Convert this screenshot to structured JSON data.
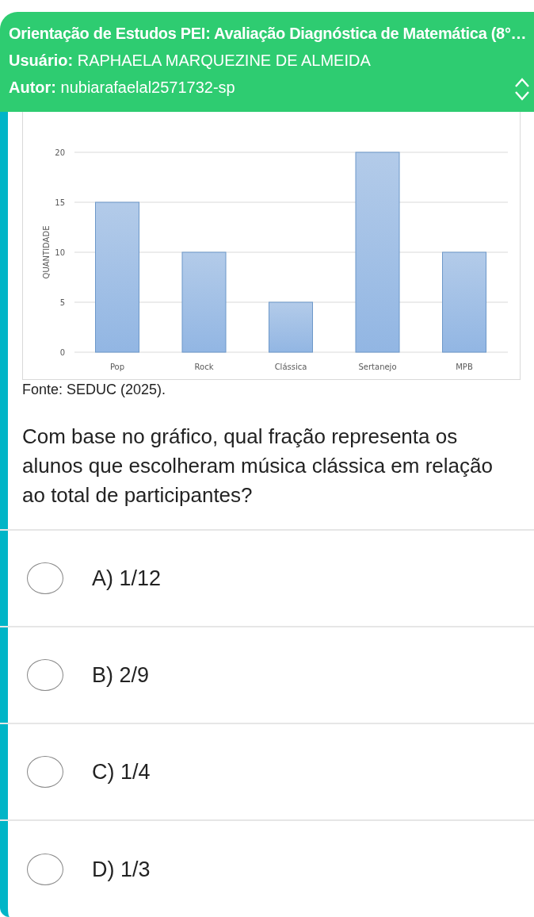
{
  "header": {
    "title": "Orientação de Estudos PEI: Avaliação Diagnóstica de Matemática (8°…",
    "user_label": "Usuário:",
    "user": "RAPHAELA MARQUEZINE DE ALMEIDA",
    "author_label": "Autor:",
    "author": "nubiarafaelal2571732-sp"
  },
  "chart": {
    "chart_data": {
      "type": "bar",
      "ylabel": "QUANTIDADE",
      "categories": [
        "Pop",
        "Rock",
        "Clássica",
        "Sertanejo",
        "MPB"
      ],
      "values": [
        15,
        10,
        5,
        20,
        10
      ],
      "ylim": [
        0,
        20
      ],
      "grid": true,
      "yticks": [
        0,
        5,
        10,
        15,
        20
      ]
    },
    "source": "Fonte: SEDUC (2025)."
  },
  "question": "Com base no gráfico, qual fração representa os alunos que escolheram música clássica em relação ao total de participantes?",
  "options": [
    {
      "label": "A) 1/12",
      "selected": false
    },
    {
      "label": "B) 2/9",
      "selected": false
    },
    {
      "label": "C) 1/4",
      "selected": false
    },
    {
      "label": "D) 1/3",
      "selected": false
    }
  ]
}
